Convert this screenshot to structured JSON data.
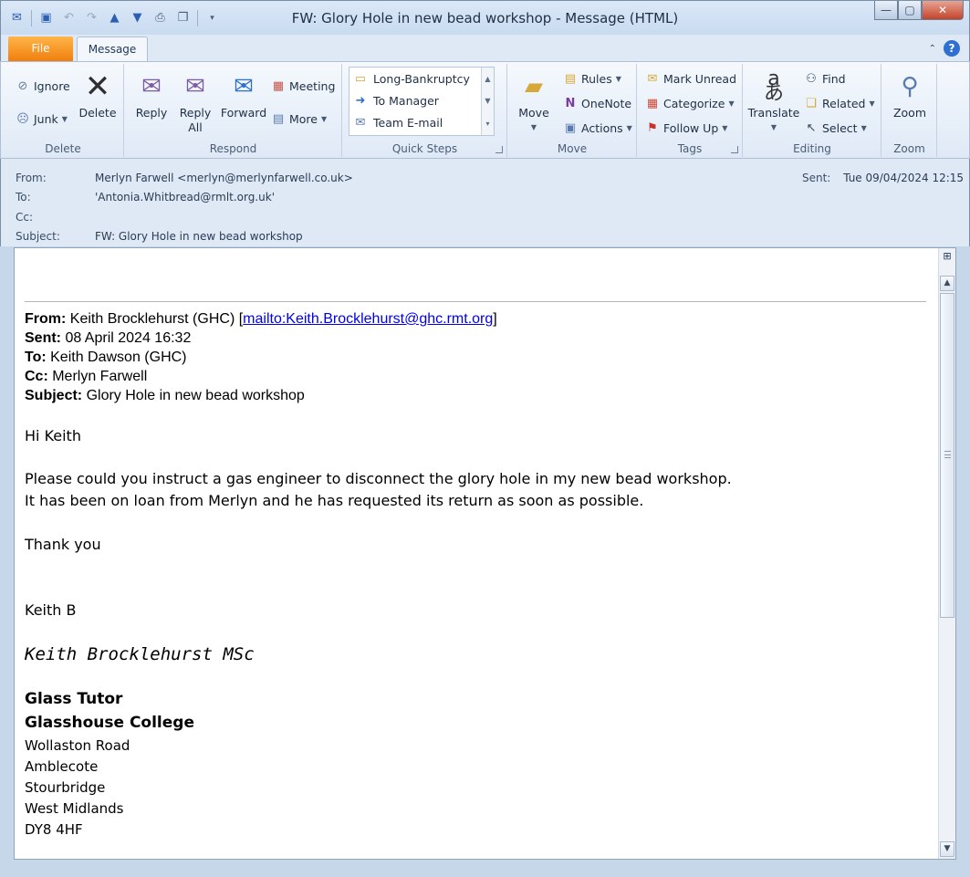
{
  "window": {
    "title": "FW: Glory Hole in new bead workshop  -  Message (HTML)"
  },
  "tabs": {
    "file": "File",
    "message": "Message"
  },
  "ribbon": {
    "delete_group": {
      "label": "Delete",
      "ignore": "Ignore",
      "junk": "Junk",
      "delete": "Delete"
    },
    "respond_group": {
      "label": "Respond",
      "reply": "Reply",
      "reply_all_1": "Reply",
      "reply_all_2": "All",
      "forward": "Forward",
      "meeting": "Meeting",
      "more": "More"
    },
    "quick_steps_group": {
      "label": "Quick Steps",
      "items": [
        "Long-Bankruptcy",
        "To Manager",
        "Team E-mail"
      ]
    },
    "move_group": {
      "label": "Move",
      "move": "Move",
      "rules": "Rules",
      "onenote": "OneNote",
      "actions": "Actions"
    },
    "tags_group": {
      "label": "Tags",
      "mark_unread": "Mark Unread",
      "categorize": "Categorize",
      "follow_up": "Follow Up"
    },
    "editing_group": {
      "label": "Editing",
      "translate": "Translate",
      "find": "Find",
      "related": "Related",
      "select": "Select"
    },
    "zoom_group": {
      "label": "Zoom",
      "zoom": "Zoom"
    }
  },
  "header": {
    "from_label": "From:",
    "from_value": "Merlyn Farwell <merlyn@merlynfarwell.co.uk>",
    "to_label": "To:",
    "to_value": "'Antonia.Whitbread@rmlt.org.uk'",
    "cc_label": "Cc:",
    "cc_value": "",
    "subject_label": "Subject:",
    "subject_value": "FW: Glory Hole in new bead workshop",
    "sent_label": "Sent:",
    "sent_value": "Tue 09/04/2024 12:15"
  },
  "body": {
    "fwd_from_label": "From:",
    "fwd_from_value": " Keith Brocklehurst (GHC) [",
    "fwd_from_link": "mailto:Keith.Brocklehurst@ghc.rmt.org",
    "fwd_from_close": "]",
    "fwd_sent_label": "Sent:",
    "fwd_sent_value": " 08 April 2024 16:32",
    "fwd_to_label": "To:",
    "fwd_to_value": " Keith Dawson (GHC)",
    "fwd_cc_label": "Cc:",
    "fwd_cc_value": " Merlyn Farwell",
    "fwd_subject_label": "Subject:",
    "fwd_subject_value": " Glory Hole in new bead workshop",
    "greeting": "Hi Keith",
    "line1": "Please could you instruct a gas engineer to disconnect the glory hole in my new bead workshop.",
    "line2": "It has been on loan from Merlyn and he has requested its return as soon as possible.",
    "thanks": "Thank you",
    "signoff": "Keith B",
    "signature": "Keith Brocklehurst MSc",
    "role": "Glass Tutor",
    "org": "Glasshouse College",
    "address": [
      "Wollaston Road",
      "Amblecote",
      "Stourbridge",
      "West Midlands",
      "DY8 4HF"
    ]
  }
}
